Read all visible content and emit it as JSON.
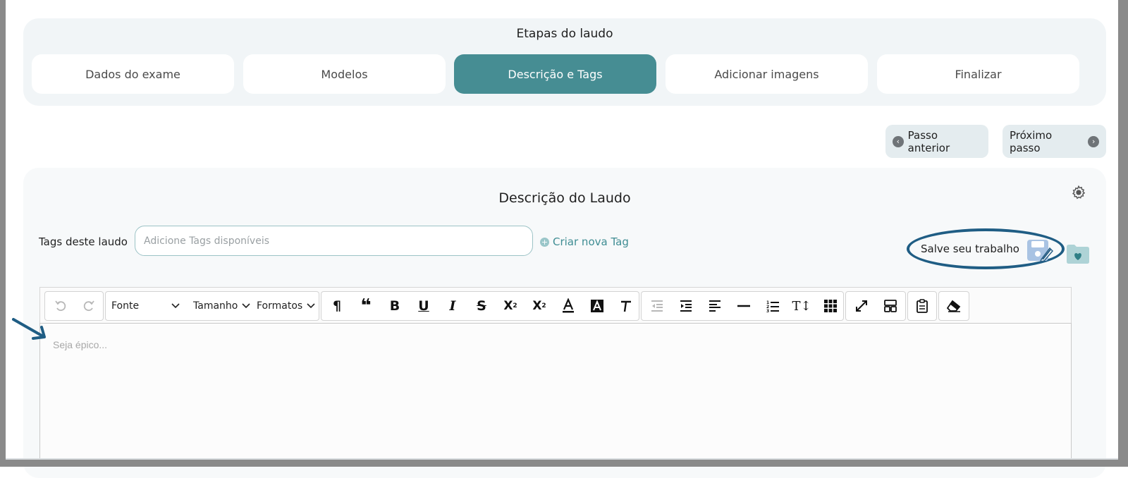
{
  "steps": {
    "title": "Etapas do laudo",
    "items": [
      {
        "label": "Dados do exame",
        "active": false
      },
      {
        "label": "Modelos",
        "active": false
      },
      {
        "label": "Descrição e Tags",
        "active": true
      },
      {
        "label": "Adicionar imagens",
        "active": false
      },
      {
        "label": "Finalizar",
        "active": false
      }
    ]
  },
  "nav": {
    "prev_label": "Passo anterior",
    "next_label": "Próximo passo"
  },
  "card": {
    "title": "Descrição do Laudo",
    "tags_label": "Tags deste laudo",
    "tags_placeholder": "Adicione Tags disponíveis",
    "new_tag_label": "Criar nova Tag",
    "save_label": "Salve seu trabalho"
  },
  "editor": {
    "font_label": "Fonte",
    "size_label": "Tamanho",
    "formats_label": "Formatos",
    "placeholder": "Seja épico..."
  },
  "colors": {
    "accent": "#468d93",
    "annotation": "#1f5d84"
  }
}
